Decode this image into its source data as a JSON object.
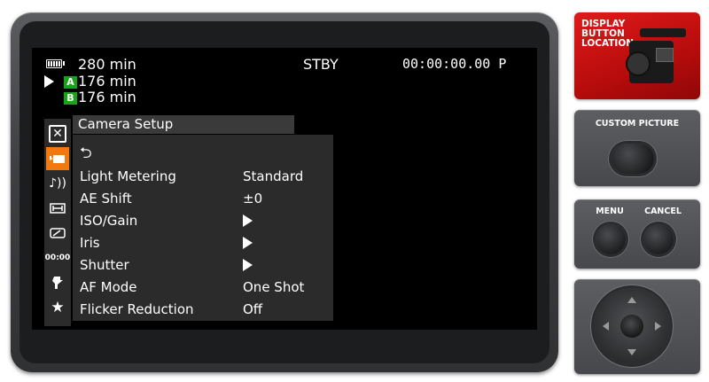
{
  "status": {
    "battery_time": "280 min",
    "slot_a_label": "A",
    "slot_a_time": "176 min",
    "slot_b_label": "B",
    "slot_b_time": "176 min",
    "mode": "STBY",
    "timecode": "00:00:00.00 P"
  },
  "tabs": [
    {
      "name": "close-icon",
      "glyph": "✕"
    },
    {
      "name": "camera-icon",
      "glyph": "▰",
      "active": true
    },
    {
      "name": "audio-icon",
      "glyph": "♪"
    },
    {
      "name": "video-icon",
      "glyph": "⊞"
    },
    {
      "name": "card-icon",
      "glyph": "▭"
    },
    {
      "name": "timecode-icon",
      "glyph": "00:00"
    },
    {
      "name": "system-icon",
      "glyph": "⚙"
    },
    {
      "name": "favorites-icon",
      "glyph": "★"
    }
  ],
  "menu": {
    "title": "Camera Setup",
    "back_glyph": "⮌",
    "items": [
      {
        "label": "Light Metering",
        "value": "Standard"
      },
      {
        "label": "AE Shift",
        "value": "±0"
      },
      {
        "label": "ISO/Gain",
        "value": ""
      },
      {
        "label": "Iris",
        "value": ""
      },
      {
        "label": "Shutter",
        "value": ""
      },
      {
        "label": "AF Mode",
        "value": "One Shot"
      },
      {
        "label": "Flicker Reduction",
        "value": "Off"
      }
    ]
  },
  "side": {
    "display_button": "DISPLAY BUTTON LOCATION",
    "custom_picture": "CUSTOM PICTURE",
    "menu": "MENU",
    "cancel": "CANCEL"
  },
  "colors": {
    "accent_tab": "#f07a10",
    "slot_badge": "#1aa31a",
    "red_panel": "#c80f0f"
  }
}
